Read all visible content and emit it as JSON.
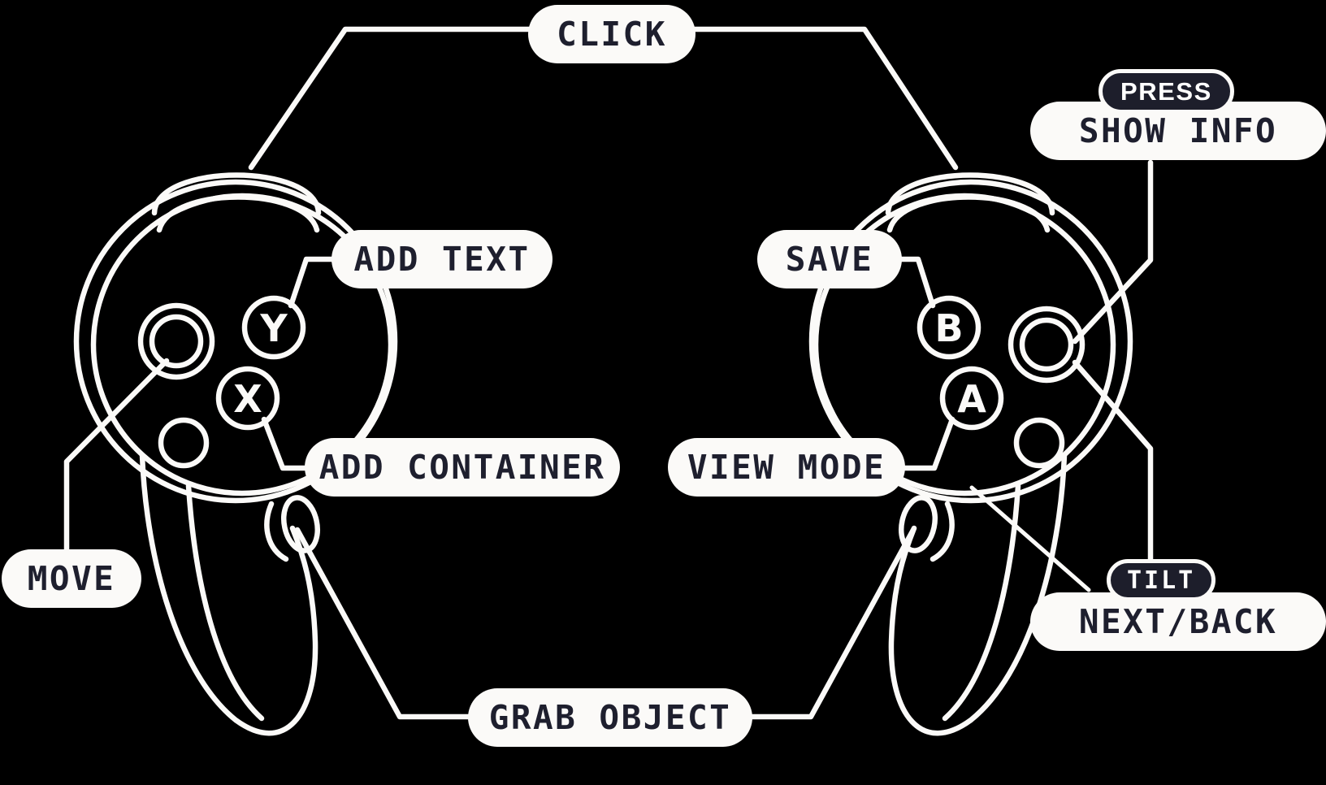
{
  "theme": {
    "background": "#000000",
    "line_color": "#fbfaf8",
    "pill_bg": "#fbfaf8",
    "pill_text": "#1e1f2e",
    "badge_bg": "#1d1e2b",
    "badge_text": "#ffffff"
  },
  "diagram": {
    "title": "Gamepad control mapping",
    "left_controller": {
      "name": "left-controller",
      "buttons": [
        {
          "glyph": "Y",
          "name": "button-y"
        },
        {
          "glyph": "X",
          "name": "button-x"
        }
      ],
      "stick": {
        "name": "left-analog-stick"
      },
      "extra_button": {
        "name": "left-small-button"
      }
    },
    "right_controller": {
      "name": "right-controller",
      "buttons": [
        {
          "glyph": "B",
          "name": "button-b"
        },
        {
          "glyph": "A",
          "name": "button-a"
        }
      ],
      "stick": {
        "name": "right-analog-stick"
      },
      "extra_button": {
        "name": "right-small-button"
      }
    }
  },
  "labels": {
    "click": "CLICK",
    "add_text": "ADD TEXT",
    "add_container": "ADD CONTAINER",
    "move": "MOVE",
    "grab_object": "GRAB OBJECT",
    "save": "SAVE",
    "view_mode": "VIEW MODE",
    "show_info": "SHOW INFO",
    "next_back": "NEXT/BACK"
  },
  "badges": {
    "press": "PRESS",
    "tilt": "TILT"
  },
  "buttons": {
    "y": "Y",
    "x": "X",
    "b": "B",
    "a": "A"
  },
  "mappings": [
    {
      "action": "CLICK",
      "control": "left-shoulder-bumper"
    },
    {
      "action": "ADD TEXT",
      "control": "button-y"
    },
    {
      "action": "ADD CONTAINER",
      "control": "button-x"
    },
    {
      "action": "MOVE",
      "control": "left-analog-stick"
    },
    {
      "action": "GRAB OBJECT",
      "control": "left-trigger"
    },
    {
      "action": "SAVE",
      "control": "button-b"
    },
    {
      "action": "VIEW MODE",
      "control": "button-a"
    },
    {
      "action": "SHOW INFO",
      "control": "right-analog-stick",
      "modifier": "PRESS"
    },
    {
      "action": "NEXT/BACK",
      "control": "right-analog-stick",
      "modifier": "TILT"
    }
  ]
}
